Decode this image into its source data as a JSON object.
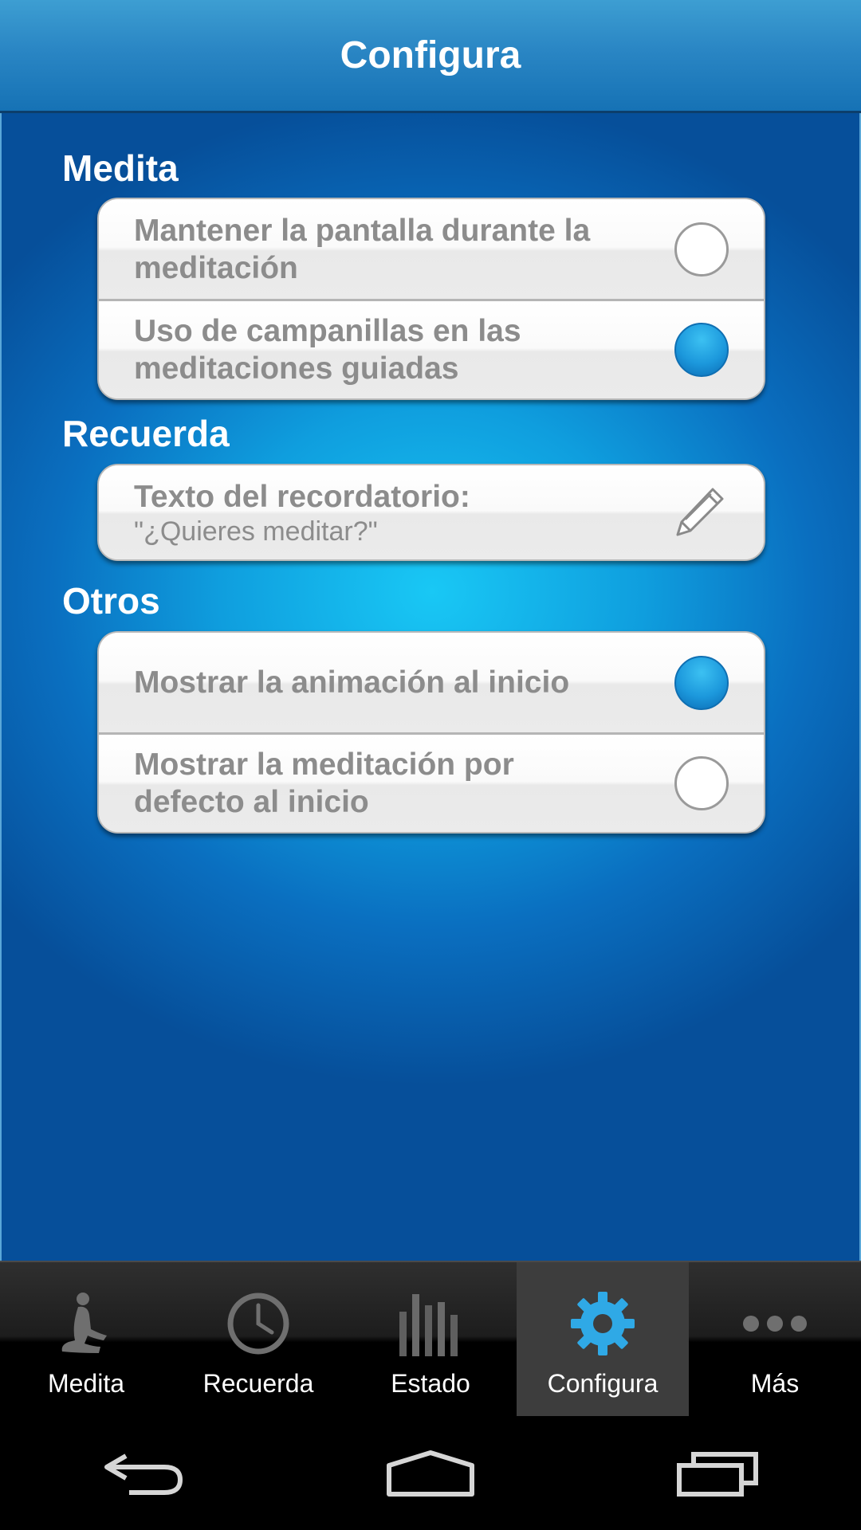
{
  "header": {
    "title": "Configura"
  },
  "sections": [
    {
      "title": "Medita",
      "rows": [
        {
          "label": "Mantener la pantalla durante la meditación",
          "state": "off"
        },
        {
          "label": "Uso de campanillas en las meditaciones guiadas",
          "state": "on"
        }
      ]
    },
    {
      "title": "Recuerda",
      "rows": [
        {
          "label": "Texto del recordatorio:",
          "value": "\"¿Quieres meditar?\"",
          "icon": "pencil-icon"
        }
      ]
    },
    {
      "title": "Otros",
      "rows": [
        {
          "label": "Mostrar la animación al inicio",
          "state": "on"
        },
        {
          "label": "Mostrar la meditación por defecto al inicio",
          "state": "off"
        }
      ]
    }
  ],
  "tabbar": {
    "tabs": [
      {
        "label": "Medita",
        "icon": "meditation-figure-icon"
      },
      {
        "label": "Recuerda",
        "icon": "clock-icon"
      },
      {
        "label": "Estado",
        "icon": "bar-chart-icon"
      },
      {
        "label": "Configura",
        "icon": "gear-icon",
        "active": true
      },
      {
        "label": "Más",
        "icon": "more-dots-icon"
      }
    ]
  },
  "navbar": {
    "buttons": [
      "back-icon",
      "home-icon",
      "recent-apps-icon"
    ]
  },
  "colors": {
    "accent": "#1c98dc",
    "header": "#2a86c4",
    "background": "#0f9ede"
  }
}
